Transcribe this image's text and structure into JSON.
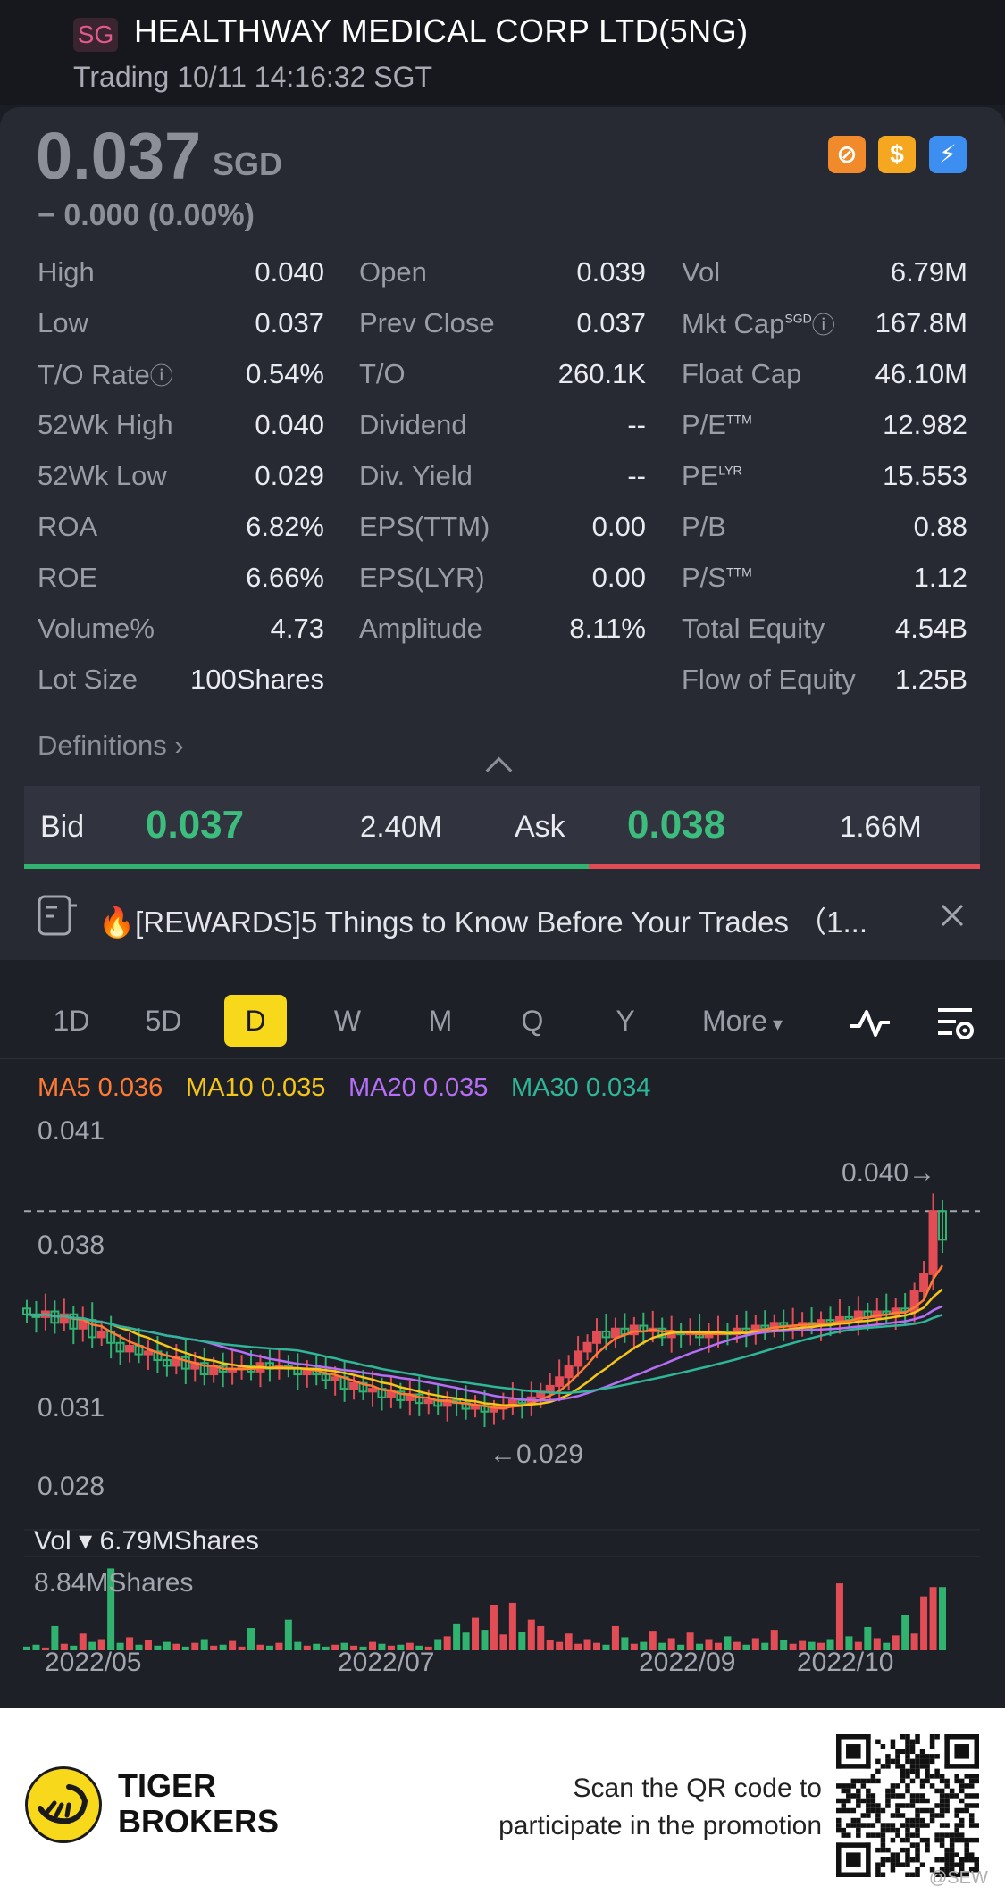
{
  "header": {
    "market_badge": "SG",
    "title": "HEALTHWAY MEDICAL CORP LTD(5NG)",
    "status": "Trading 10/11 14:16:32 SGT"
  },
  "quote": {
    "price": "0.037",
    "currency": "SGD",
    "change": "0.000 (0.00%)",
    "change_prefix": "−"
  },
  "stats": {
    "col1": [
      {
        "label": "High",
        "value": "0.040"
      },
      {
        "label": "Low",
        "value": "0.037"
      },
      {
        "label": "T/O Rate",
        "value": "0.54%"
      },
      {
        "label": "52Wk High",
        "value": "0.040"
      },
      {
        "label": "52Wk Low",
        "value": "0.029"
      },
      {
        "label": "ROA",
        "value": "6.82%"
      },
      {
        "label": "ROE",
        "value": "6.66%"
      },
      {
        "label": "Volume%",
        "value": "4.73"
      },
      {
        "label": "Lot Size",
        "value": "100Shares"
      }
    ],
    "col2": [
      {
        "label": "Open",
        "value": "0.039"
      },
      {
        "label": "Prev Close",
        "value": "0.037"
      },
      {
        "label": "T/O",
        "value": "260.1K"
      },
      {
        "label": "Dividend",
        "value": "--"
      },
      {
        "label": "Div. Yield",
        "value": "--"
      },
      {
        "label": "EPS(TTM)",
        "value": "0.00"
      },
      {
        "label": "EPS(LYR)",
        "value": "0.00"
      },
      {
        "label": "Amplitude",
        "value": "8.11%"
      }
    ],
    "col3": [
      {
        "label": "Vol",
        "value": "6.79M",
        "sup": ""
      },
      {
        "label": "Mkt Cap",
        "value": "167.8M",
        "sup": "SGD"
      },
      {
        "label": "Float Cap",
        "value": "46.10M",
        "sup": ""
      },
      {
        "label": "P/E",
        "value": "12.982",
        "sup": "TTM"
      },
      {
        "label": "PE",
        "value": "15.553",
        "sup": "LYR"
      },
      {
        "label": "P/B",
        "value": "0.88",
        "sup": ""
      },
      {
        "label": "P/S",
        "value": "1.12",
        "sup": "TTM"
      },
      {
        "label": "Total Equity",
        "value": "4.54B",
        "sup": ""
      },
      {
        "label": "Flow of Equity",
        "value": "1.25B",
        "sup": ""
      }
    ],
    "definitions": "Definitions"
  },
  "orderbook": {
    "bid_label": "Bid",
    "bid_price": "0.037",
    "bid_size": "2.40M",
    "ask_label": "Ask",
    "ask_price": "0.038",
    "ask_size": "1.66M"
  },
  "news": {
    "text": "🔥[REWARDS]5 Things to Know Before Your Trades （1..."
  },
  "tabs": [
    "1D",
    "5D",
    "D",
    "W",
    "M",
    "Q",
    "Y",
    "More"
  ],
  "active_tab": "D",
  "ma": [
    {
      "label": "MA5 0.036",
      "color": "#ff7b33"
    },
    {
      "label": "MA10 0.035",
      "color": "#f5c518"
    },
    {
      "label": "MA20 0.035",
      "color": "#b56ef5"
    },
    {
      "label": "MA30 0.034",
      "color": "#2fb597"
    }
  ],
  "volume": {
    "label": "Vol",
    "value": "6.79MShares",
    "max_label": "8.84MShares"
  },
  "chart_data": {
    "type": "candlestick",
    "y_ticks": [
      "0.041",
      "0.038",
      "0.031",
      "0.028"
    ],
    "ylim": [
      0.028,
      0.041
    ],
    "last_price_line": 0.038,
    "high_annotation": "0.040→",
    "low_annotation": "←0.029",
    "x_labels": [
      "2022/05",
      "2022/07",
      "2022/09",
      "2022/10"
    ],
    "up_color": "#e24c55",
    "down_color": "#2fb36f",
    "closes": [
      0.0344,
      0.0343,
      0.0345,
      0.0341,
      0.0344,
      0.0339,
      0.0342,
      0.0336,
      0.0338,
      0.0334,
      0.0331,
      0.0333,
      0.033,
      0.0331,
      0.0328,
      0.0326,
      0.0329,
      0.0325,
      0.0327,
      0.0323,
      0.0326,
      0.0324,
      0.0325,
      0.0326,
      0.0324,
      0.0327,
      0.0325,
      0.0326,
      0.0325,
      0.0323,
      0.0325,
      0.0323,
      0.0321,
      0.0322,
      0.0318,
      0.032,
      0.0317,
      0.0318,
      0.0315,
      0.0317,
      0.0314,
      0.0316,
      0.0313,
      0.0314,
      0.0312,
      0.0314,
      0.0313,
      0.0311,
      0.0312,
      0.031,
      0.0311,
      0.0312,
      0.0314,
      0.0313,
      0.0315,
      0.0317,
      0.0319,
      0.0322,
      0.0326,
      0.0331,
      0.0334,
      0.0338,
      0.0336,
      0.0339,
      0.0337,
      0.034,
      0.0338,
      0.0339,
      0.0336,
      0.0338,
      0.0337,
      0.0338,
      0.0336,
      0.0337,
      0.0338,
      0.0337,
      0.0339,
      0.0338,
      0.034,
      0.0339,
      0.0341,
      0.034,
      0.034,
      0.0341,
      0.034,
      0.0342,
      0.0341,
      0.0343,
      0.0342,
      0.0345,
      0.0343,
      0.0345,
      0.0344,
      0.0346,
      0.0345,
      0.0352,
      0.0358,
      0.038,
      0.037
    ],
    "volumes": [
      0.4,
      0.6,
      0.3,
      2.6,
      0.7,
      0.5,
      1.8,
      0.9,
      1.2,
      8.8,
      0.8,
      1.4,
      0.6,
      1.1,
      0.5,
      0.9,
      0.7,
      0.4,
      0.8,
      1.2,
      0.5,
      0.6,
      1.0,
      0.4,
      2.4,
      0.6,
      0.5,
      0.8,
      3.3,
      0.9,
      0.5,
      0.7,
      0.4,
      0.6,
      0.8,
      0.5,
      0.4,
      0.9,
      0.7,
      0.5,
      0.6,
      0.8,
      0.5,
      0.4,
      1.2,
      1.5,
      2.8,
      1.9,
      3.5,
      2.2,
      4.9,
      1.7,
      5.1,
      2.0,
      3.3,
      2.6,
      1.1,
      0.9,
      1.8,
      0.7,
      1.2,
      0.8,
      0.6,
      2.6,
      1.4,
      0.7,
      0.9,
      2.1,
      0.8,
      1.3,
      0.6,
      1.9,
      0.7,
      1.2,
      0.8,
      1.5,
      0.9,
      0.6,
      1.3,
      0.8,
      2.2,
      1.1,
      0.7,
      1.0,
      0.9,
      0.8,
      1.2,
      7.2,
      1.5,
      0.9,
      2.5,
      1.3,
      0.8,
      1.6,
      3.8,
      1.8,
      5.8,
      6.8,
      6.8
    ]
  },
  "footer": {
    "brand": "TIGER\nBROKERS",
    "brand_line1": "TIGER",
    "brand_line2": "BROKERS",
    "promo_line1": "Scan the QR code to",
    "promo_line2": "participate in the promotion",
    "watermark": "@SEW"
  }
}
